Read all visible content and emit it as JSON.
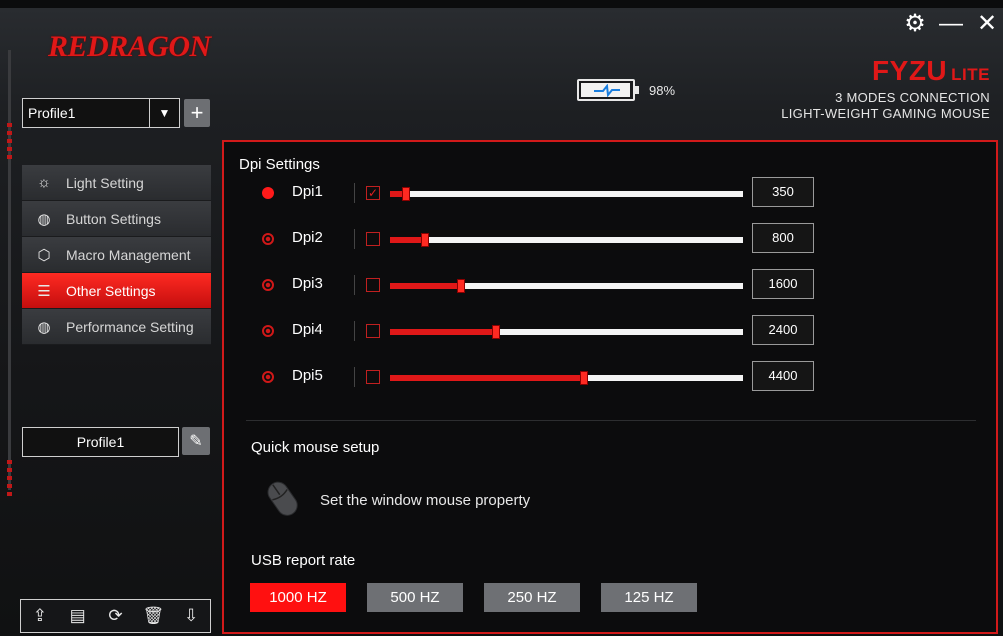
{
  "brand": "REDRAGON",
  "window_controls": {
    "settings": "⚙",
    "minimize": "—",
    "close": "✕"
  },
  "product": {
    "name": "FYZU",
    "edition": "LITE",
    "line1": "3 MODES CONNECTION",
    "line2": "LIGHT-WEIGHT GAMING MOUSE"
  },
  "battery": {
    "percent_label": "98%",
    "level": 0.98
  },
  "sidebar": {
    "profile_select": "Profile1",
    "menu": [
      {
        "label": "Light Setting",
        "icon": "bulb-icon"
      },
      {
        "label": "Button Settings",
        "icon": "mouse-button-icon"
      },
      {
        "label": "Macro Management",
        "icon": "cube-icon"
      },
      {
        "label": "Other Settings",
        "icon": "sliders-icon",
        "active": true
      },
      {
        "label": "Performance Setting",
        "icon": "gauge-icon"
      }
    ],
    "profile_name": "Profile1"
  },
  "dpi": {
    "title": "Dpi Settings",
    "max": 8000,
    "rows": [
      {
        "label": "Dpi1",
        "value": "350",
        "active": true,
        "checked": true
      },
      {
        "label": "Dpi2",
        "value": "800",
        "active": false,
        "checked": false
      },
      {
        "label": "Dpi3",
        "value": "1600",
        "active": false,
        "checked": false
      },
      {
        "label": "Dpi4",
        "value": "2400",
        "active": false,
        "checked": false
      },
      {
        "label": "Dpi5",
        "value": "4400",
        "active": false,
        "checked": false
      }
    ]
  },
  "quick_setup": {
    "title": "Quick mouse setup",
    "text": "Set the window mouse property"
  },
  "usb": {
    "title": "USB report rate",
    "rates": [
      "1000 HZ",
      "500 HZ",
      "250 HZ",
      "125 HZ"
    ],
    "selected": 0
  },
  "colors": {
    "accent": "#e01818",
    "active_button": "#ff1010",
    "button": "#6e7074"
  }
}
